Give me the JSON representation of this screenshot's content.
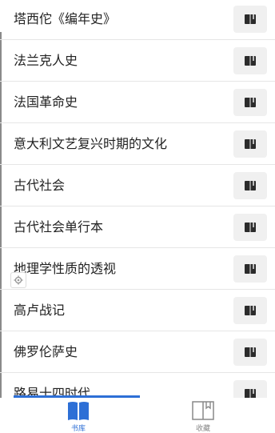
{
  "books": [
    {
      "title": "塔西佗《编年史》"
    },
    {
      "title": "法兰克人史"
    },
    {
      "title": "法国革命史"
    },
    {
      "title": "意大利文艺复兴时期的文化"
    },
    {
      "title": "古代社会"
    },
    {
      "title": "古代社会单行本"
    },
    {
      "title": "地理学性质的透视"
    },
    {
      "title": "高卢战记"
    },
    {
      "title": "佛罗伦萨史"
    },
    {
      "title": "路易十四时代"
    }
  ],
  "tabs": {
    "library": {
      "label": "书库",
      "icon": "book-open-icon",
      "active": true
    },
    "favorites": {
      "label": "收藏",
      "icon": "bookmark-book-icon",
      "active": false
    }
  },
  "row_action_icon": "book-icon",
  "floating_icon": "settings-gear-icon",
  "colors": {
    "accent": "#2d6fd6",
    "button_bg": "#f0f0f0",
    "separator": "#e6e6e6"
  }
}
